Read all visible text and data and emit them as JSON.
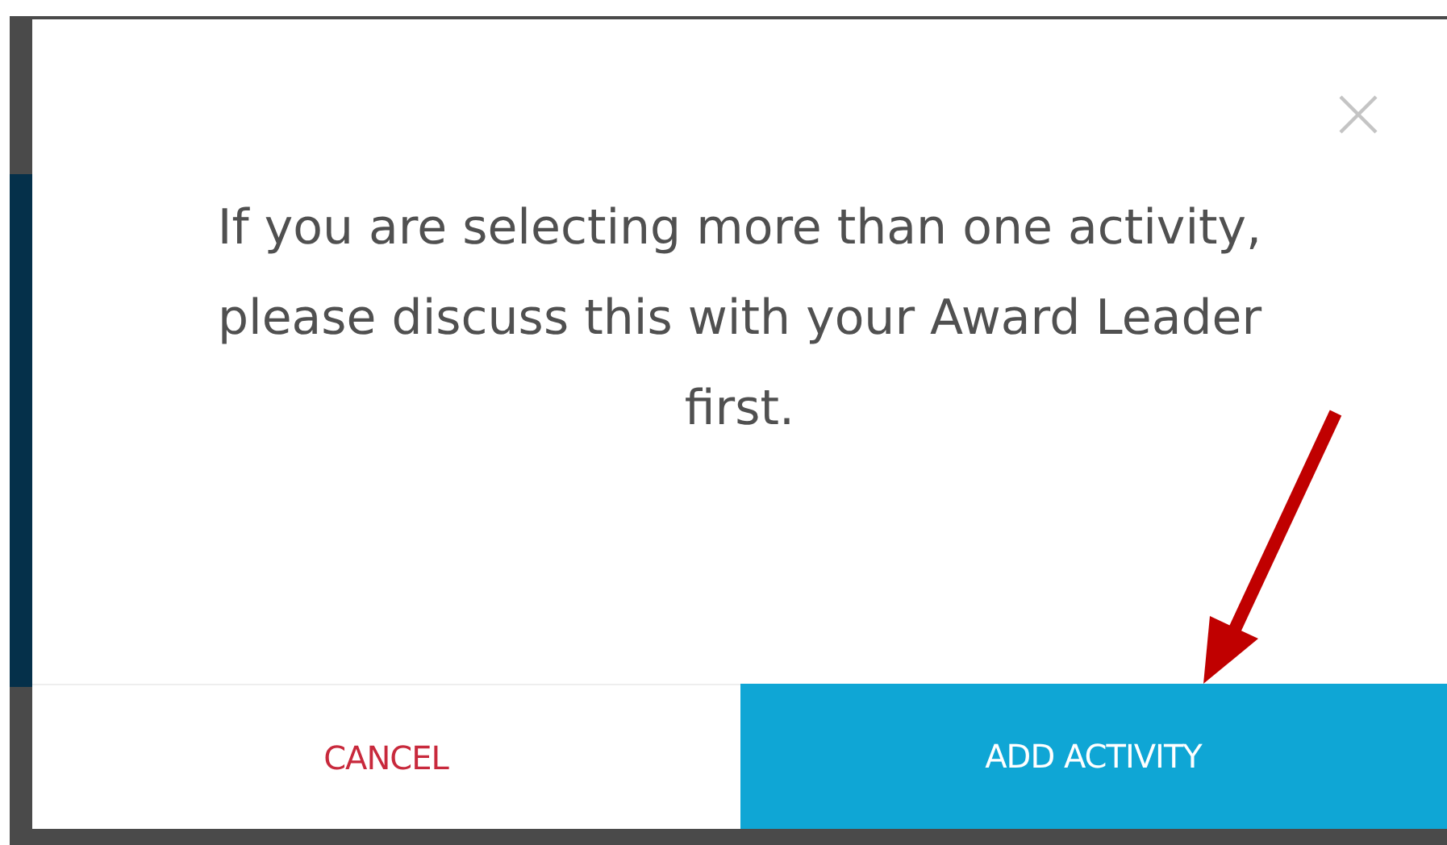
{
  "dialog": {
    "message": "If you are selecting more than one activity, please discuss this with your Award Leader first.",
    "buttons": [
      {
        "label": "CANCEL",
        "kind": "secondary"
      },
      {
        "label": "ADD ACTIVITY",
        "kind": "primary"
      }
    ]
  }
}
